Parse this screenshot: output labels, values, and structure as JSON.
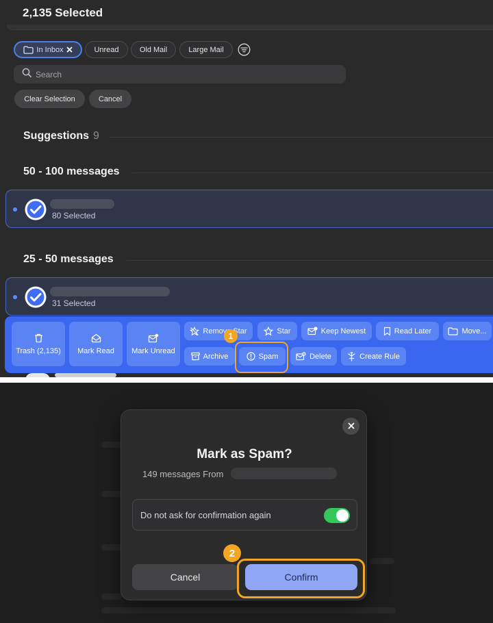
{
  "header": {
    "title": "2,135 Selected"
  },
  "filters": [
    {
      "label": "In Inbox",
      "active": true,
      "icon": "folder-icon",
      "removable": true
    },
    {
      "label": "Unread"
    },
    {
      "label": "Old Mail"
    },
    {
      "label": "Large Mail"
    }
  ],
  "search": {
    "placeholder": "Search"
  },
  "actions": {
    "clear_selection": "Clear Selection",
    "cancel": "Cancel"
  },
  "suggestions": {
    "label": "Suggestions",
    "count": "9"
  },
  "groups": [
    {
      "heading": "50 - 100 messages",
      "selected_text": "80 Selected"
    },
    {
      "heading": "25 - 50 messages",
      "selected_text": "31 Selected"
    }
  ],
  "toolbar": {
    "big_buttons": [
      {
        "label": "Trash (2,135)",
        "icon": "trash-icon"
      },
      {
        "label": "Mark Read",
        "icon": "envelope-open-icon"
      },
      {
        "label": "Mark Unread",
        "icon": "envelope-dot-icon"
      }
    ],
    "row1": [
      {
        "label": "Remove Star",
        "icon": "star-slash-icon"
      },
      {
        "label": "Star",
        "icon": "star-icon"
      },
      {
        "label": "Keep Newest",
        "icon": "keep-newest-icon"
      },
      {
        "label": "Read Later",
        "icon": "bookmark-icon"
      },
      {
        "label": "Move...",
        "icon": "folder-icon"
      }
    ],
    "row2": [
      {
        "label": "Archive",
        "icon": "archive-icon"
      },
      {
        "label": "Spam",
        "icon": "spam-icon"
      },
      {
        "label": "Delete",
        "icon": "delete-icon"
      },
      {
        "label": "Create Rule",
        "icon": "rule-icon"
      }
    ]
  },
  "step_badges": {
    "first": "1",
    "second": "2"
  },
  "highlight_color": "#f3a623",
  "accent_color": "#3a67f0",
  "dialog": {
    "title": "Mark as Spam?",
    "subtitle": "149 messages From",
    "option_label": "Do not ask for confirmation again",
    "option_enabled": true,
    "cancel_label": "Cancel",
    "confirm_label": "Confirm"
  }
}
